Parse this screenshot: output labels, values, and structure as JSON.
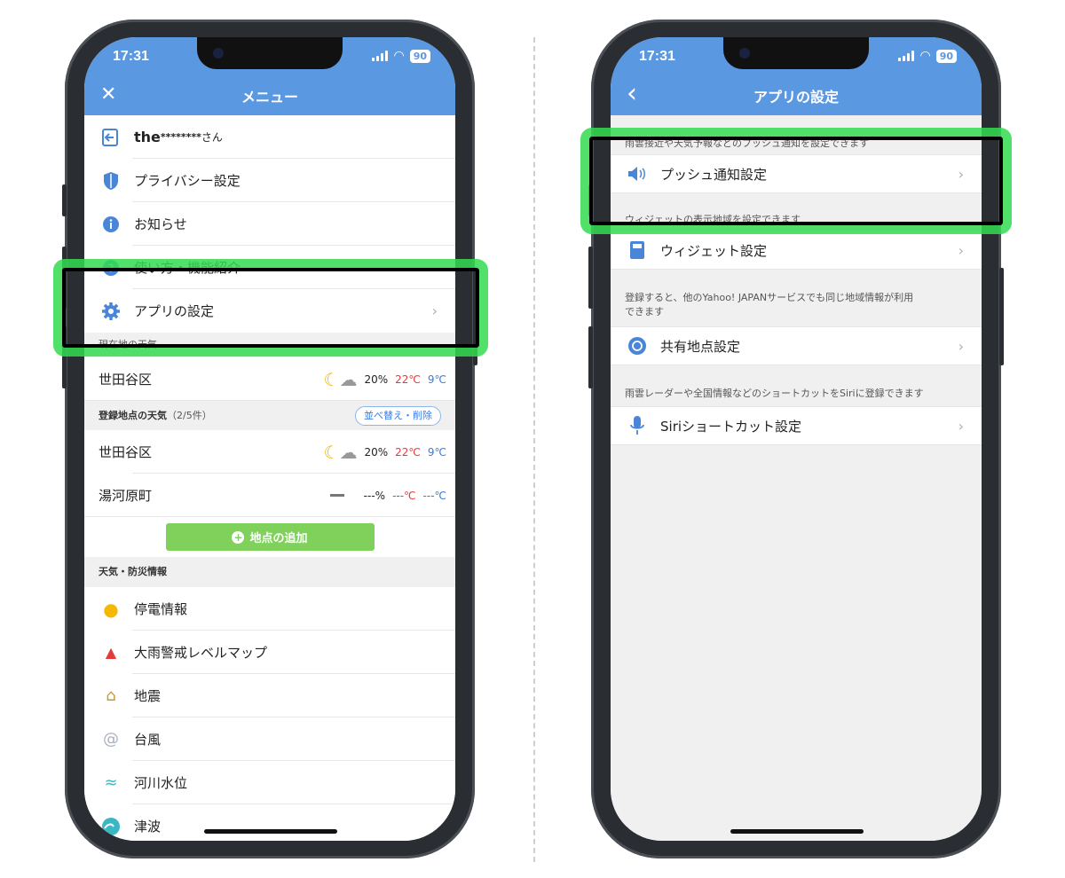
{
  "left": {
    "status": {
      "time": "17:31",
      "battery": "90"
    },
    "header": {
      "title": "メニュー",
      "close_glyph": "✕"
    },
    "menu": [
      {
        "label_strong": "the",
        "label_mask": "********",
        "label_suffix": " さん",
        "icon": "logout-icon"
      },
      {
        "label": "プライバシー設定",
        "icon": "shield-icon"
      },
      {
        "label": "お知らせ",
        "icon": "info-icon"
      },
      {
        "label": "使い方・機能紹介",
        "icon": "help-icon"
      },
      {
        "label": "アプリの設定",
        "icon": "gear-icon"
      }
    ],
    "current_section": "現在地の天気",
    "current_weather": {
      "place": "世田谷区",
      "rain": "20%",
      "high": "22℃",
      "low": "9℃"
    },
    "registered": {
      "title": "登録地点の天気",
      "count": "（2/5件）",
      "sort_button": "並べ替え・削除",
      "rows": [
        {
          "place": "世田谷区",
          "rain": "20%",
          "high": "22℃",
          "low": "9℃"
        },
        {
          "place": "湯河原町",
          "rain": "---%",
          "high": "---℃",
          "low": "---℃"
        }
      ],
      "add_button": "地点の追加"
    },
    "disaster": {
      "title": "天気・防災情報",
      "items": [
        "停電情報",
        "大雨警戒レベルマップ",
        "地震",
        "台風",
        "河川水位",
        "津波"
      ]
    }
  },
  "right": {
    "status": {
      "time": "17:31",
      "battery": "90"
    },
    "header": {
      "title": "アプリの設定",
      "back_glyph": "‹"
    },
    "sections": [
      {
        "note": "雨雲接近や天気予報などのプッシュ通知を設定できます",
        "label": "プッシュ通知設定",
        "icon": "speaker-icon"
      },
      {
        "note": "ウィジェットの表示地域を設定できます",
        "label": "ウィジェット設定",
        "icon": "widget-icon"
      },
      {
        "note": "登録すると、他のYahoo! JAPANサービスでも同じ地域情報が利用できます",
        "label": "共有地点設定",
        "icon": "sync-icon"
      },
      {
        "note": "雨雲レーダーや全国情報などのショートカットをSiriに登録できます",
        "label": "Siriショートカット設定",
        "icon": "microphone-icon"
      }
    ]
  },
  "colors": {
    "header": "#5b98e2",
    "highlight": "#33dd55",
    "add_button": "#7fd15c",
    "high_temp": "#e23b3b",
    "low_temp": "#3a7be0"
  }
}
